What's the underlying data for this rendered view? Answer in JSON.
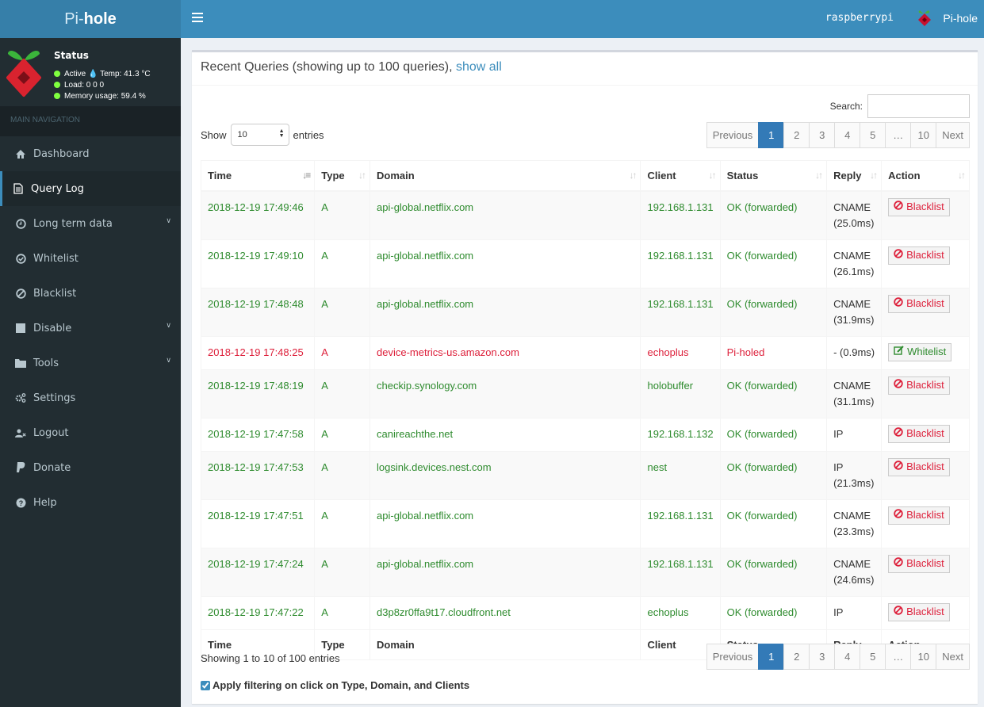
{
  "app": {
    "logo_light": "Pi-",
    "logo_bold": "hole",
    "hostname": "raspberrypi",
    "user_label": "Pi-hole"
  },
  "status": {
    "title": "Status",
    "active": "Active",
    "temp": "Temp: 41.3 °C",
    "load": "Load:  0  0  0",
    "memory": "Memory usage:  59.4 %"
  },
  "nav": {
    "header": "MAIN NAVIGATION",
    "items": [
      {
        "label": "Dashboard",
        "icon": "home-icon"
      },
      {
        "label": "Query Log",
        "icon": "file-text-icon",
        "active": true
      },
      {
        "label": "Long term data",
        "icon": "clock-icon",
        "has_children": true
      },
      {
        "label": "Whitelist",
        "icon": "check-circle-icon"
      },
      {
        "label": "Blacklist",
        "icon": "ban-icon"
      },
      {
        "label": "Disable",
        "icon": "stop-icon",
        "has_children": true
      },
      {
        "label": "Tools",
        "icon": "folder-icon",
        "has_children": true
      },
      {
        "label": "Settings",
        "icon": "gears-icon"
      },
      {
        "label": "Logout",
        "icon": "user-times-icon"
      },
      {
        "label": "Donate",
        "icon": "paypal-icon"
      },
      {
        "label": "Help",
        "icon": "question-circle-icon"
      }
    ]
  },
  "box": {
    "title": "Recent Queries (showing up to 100 queries), ",
    "show_all": "show all",
    "search_label": "Search:",
    "search_value": "",
    "show_label": "Show",
    "entries_label": "entries",
    "page_length": "10",
    "showing_text": "Showing 1 to 10 of 100 entries",
    "filter_label": "Apply filtering on click on Type, Domain, and Clients",
    "filter_checked": true
  },
  "pagination": {
    "previous": "Previous",
    "next": "Next",
    "pages": [
      "1",
      "2",
      "3",
      "4",
      "5",
      "…",
      "10"
    ],
    "active": "1"
  },
  "table": {
    "columns": [
      "Time",
      "Type",
      "Domain",
      "Client",
      "Status",
      "Reply",
      "Action"
    ],
    "rows": [
      {
        "time": "2018-12-19 17:49:46",
        "type": "A",
        "domain": "api-global.netflix.com",
        "client": "192.168.1.131",
        "status": "OK (forwarded)",
        "reply1": "CNAME",
        "reply2": "(25.0ms)",
        "action": "Blacklist",
        "blocked": false
      },
      {
        "time": "2018-12-19 17:49:10",
        "type": "A",
        "domain": "api-global.netflix.com",
        "client": "192.168.1.131",
        "status": "OK (forwarded)",
        "reply1": "CNAME",
        "reply2": "(26.1ms)",
        "action": "Blacklist",
        "blocked": false
      },
      {
        "time": "2018-12-19 17:48:48",
        "type": "A",
        "domain": "api-global.netflix.com",
        "client": "192.168.1.131",
        "status": "OK (forwarded)",
        "reply1": "CNAME",
        "reply2": "(31.9ms)",
        "action": "Blacklist",
        "blocked": false
      },
      {
        "time": "2018-12-19 17:48:25",
        "type": "A",
        "domain": "device-metrics-us.amazon.com",
        "client": "echoplus",
        "status": "Pi-holed",
        "reply1": "- (0.9ms)",
        "reply2": "",
        "action": "Whitelist",
        "blocked": true
      },
      {
        "time": "2018-12-19 17:48:19",
        "type": "A",
        "domain": "checkip.synology.com",
        "client": "holobuffer",
        "status": "OK (forwarded)",
        "reply1": "CNAME",
        "reply2": "(31.1ms)",
        "action": "Blacklist",
        "blocked": false
      },
      {
        "time": "2018-12-19 17:47:58",
        "type": "A",
        "domain": "canireachthe.net",
        "client": "192.168.1.132",
        "status": "OK (forwarded)",
        "reply1": "IP",
        "reply2": "",
        "action": "Blacklist",
        "blocked": false
      },
      {
        "time": "2018-12-19 17:47:53",
        "type": "A",
        "domain": "logsink.devices.nest.com",
        "client": "nest",
        "status": "OK (forwarded)",
        "reply1": "IP",
        "reply2": "(21.3ms)",
        "action": "Blacklist",
        "blocked": false
      },
      {
        "time": "2018-12-19 17:47:51",
        "type": "A",
        "domain": "api-global.netflix.com",
        "client": "192.168.1.131",
        "status": "OK (forwarded)",
        "reply1": "CNAME",
        "reply2": "(23.3ms)",
        "action": "Blacklist",
        "blocked": false
      },
      {
        "time": "2018-12-19 17:47:24",
        "type": "A",
        "domain": "api-global.netflix.com",
        "client": "192.168.1.131",
        "status": "OK (forwarded)",
        "reply1": "CNAME",
        "reply2": "(24.6ms)",
        "action": "Blacklist",
        "blocked": false
      },
      {
        "time": "2018-12-19 17:47:22",
        "type": "A",
        "domain": "d3p8zr0ffa9t17.cloudfront.net",
        "client": "echoplus",
        "status": "OK (forwarded)",
        "reply1": "IP",
        "reply2": "",
        "action": "Blacklist",
        "blocked": false
      }
    ]
  },
  "colors": {
    "header": "#3c8dbc",
    "logo_bg": "#367fa9",
    "sidebar": "#222d32",
    "ok": "#2e8b2e",
    "blocked": "#dd1f3a",
    "page_active": "#337ab7"
  }
}
